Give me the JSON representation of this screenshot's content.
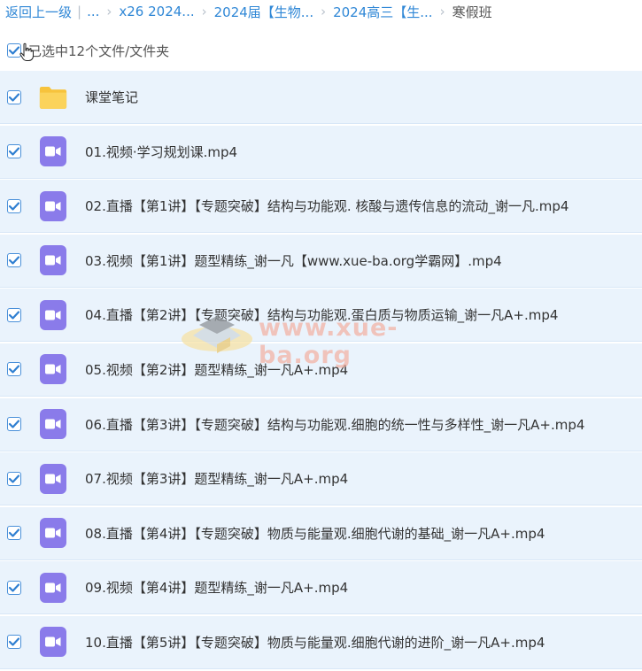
{
  "breadcrumb": {
    "back": "返回上一级",
    "divider": "|",
    "ellipsis": "...",
    "items": [
      "x26 2024...",
      "2024届【生物...",
      "2024高三【生...",
      "寒假班"
    ]
  },
  "selection": {
    "label": "已选中12个文件/文件夹",
    "checked": true
  },
  "files": [
    {
      "type": "folder",
      "name": "课堂笔记",
      "checked": true
    },
    {
      "type": "video",
      "name": "01.视频·学习规划课.mp4",
      "checked": true
    },
    {
      "type": "video",
      "name": "02.直播【第1讲】【专题突破】结构与功能观. 核酸与遗传信息的流动_谢一凡.mp4",
      "checked": true
    },
    {
      "type": "video",
      "name": "03.视频【第1讲】题型精练_谢一凡【www.xue-ba.org学霸网】.mp4",
      "checked": true
    },
    {
      "type": "video",
      "name": "04.直播【第2讲】【专题突破】结构与功能观.蛋白质与物质运输_谢一凡A+.mp4",
      "checked": true
    },
    {
      "type": "video",
      "name": "05.视频【第2讲】题型精练_谢一凡A+.mp4",
      "checked": true
    },
    {
      "type": "video",
      "name": "06.直播【第3讲】【专题突破】结构与功能观.细胞的统一性与多样性_谢一凡A+.mp4",
      "checked": true
    },
    {
      "type": "video",
      "name": "07.视频【第3讲】题型精练_谢一凡A+.mp4",
      "checked": true
    },
    {
      "type": "video",
      "name": "08.直播【第4讲】【专题突破】物质与能量观.细胞代谢的基础_谢一凡A+.mp4",
      "checked": true
    },
    {
      "type": "video",
      "name": "09.视频【第4讲】题型精练_谢一凡A+.mp4",
      "checked": true
    },
    {
      "type": "video",
      "name": "10.直播【第5讲】【专题突破】物质与能量观.细胞代谢的进阶_谢一凡A+.mp4",
      "checked": true
    }
  ],
  "watermark": {
    "text": "www.xue-ba.org"
  },
  "colors": {
    "link": "#2f87d6",
    "row_bg": "#eaf3fc",
    "check": "#2f7fd1",
    "video_icon": "#8a7bea",
    "folder_icon": "#f9c945"
  }
}
